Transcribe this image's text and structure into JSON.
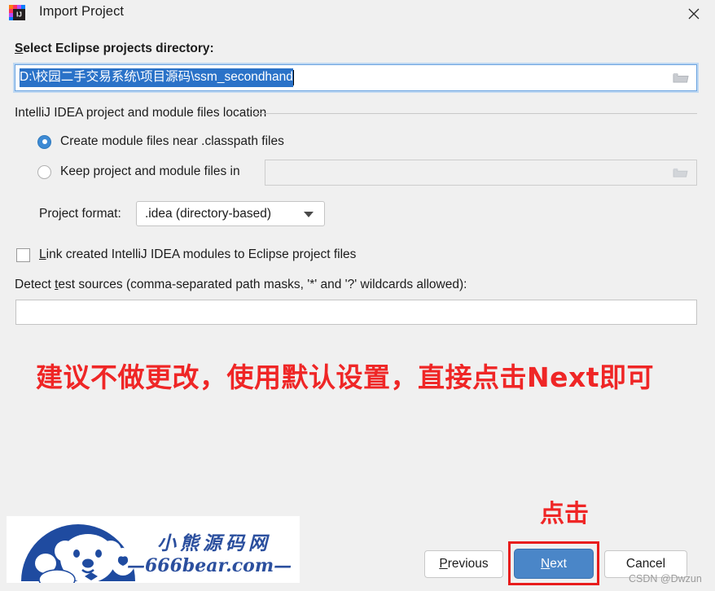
{
  "window": {
    "title": "Import Project",
    "app_icon": "intellij-idea-icon",
    "close_icon": "close-icon"
  },
  "path_section": {
    "label": "Select Eclipse projects directory:",
    "mnemonic": "S",
    "value": "D:\\校园二手交易系统\\项目源码\\ssm_secondhand",
    "placeholder": "",
    "browse_icon": "folder-icon",
    "selection_color": "#2a72c8",
    "focus_border_color": "#6aa3e0"
  },
  "group": {
    "label": "IntelliJ IDEA project and module files location",
    "radios": [
      {
        "label": "Create module files near .classpath files",
        "selected": true
      },
      {
        "label": "Keep project and module files in",
        "selected": false
      }
    ],
    "keep_field_value": "",
    "keep_field_enabled": false,
    "keep_browse_icon": "folder-icon"
  },
  "format": {
    "label": "Project format:",
    "value": ".idea (directory-based)",
    "arrow_icon": "chevron-down-icon"
  },
  "link_checkbox": {
    "label": "Link created IntelliJ IDEA modules to Eclipse project files",
    "mnemonic": "L",
    "checked": false
  },
  "detect": {
    "label": "Detect test sources (comma-separated path masks, '*' and '?' wildcards allowed):",
    "mnemonic": "t",
    "value": "",
    "placeholder": ""
  },
  "annotations": {
    "main_note": "建议不做更改，使用默认设置，直接点击Next即可",
    "click_note": "点击",
    "color": "#ef2626",
    "highlight_box_color": "#e81c1c"
  },
  "logo": {
    "title_cn": "小熊源码网",
    "url": "—666bear.com—",
    "brand_color": "#2b4f9e",
    "mascot_icon": "bear-mascot-icon"
  },
  "buttons": {
    "previous": "Previous",
    "next": "Next",
    "cancel": "Cancel",
    "next_color": "#4a86c8"
  },
  "watermark": "CSDN @Dwzun"
}
